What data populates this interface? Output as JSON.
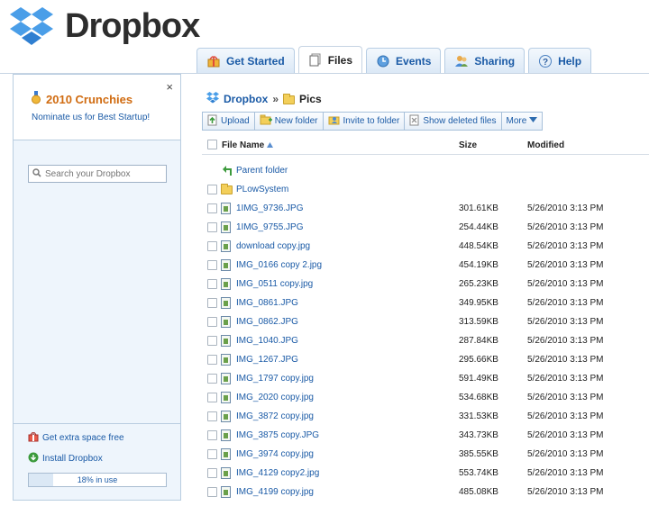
{
  "brand": {
    "name": "Dropbox"
  },
  "tabs": [
    {
      "label": "Get Started",
      "icon": "gift-box-icon",
      "active": false
    },
    {
      "label": "Files",
      "icon": "files-icon",
      "active": true
    },
    {
      "label": "Events",
      "icon": "events-icon",
      "active": false
    },
    {
      "label": "Sharing",
      "icon": "sharing-icon",
      "active": false
    },
    {
      "label": "Help",
      "icon": "help-icon",
      "active": false
    }
  ],
  "sidebar": {
    "promo_title": "2010 Crunchies",
    "promo_sub": "Nominate us for Best Startup!",
    "close": "×",
    "search_placeholder": "Search your Dropbox",
    "links": [
      {
        "label": "Get extra space free",
        "icon": "gift-icon"
      },
      {
        "label": "Install Dropbox",
        "icon": "download-icon"
      }
    ],
    "usage_label": "18% in use",
    "usage_fraction": 0.18
  },
  "breadcrumb": {
    "root": "Dropbox",
    "separator": "»",
    "current": "Pics"
  },
  "toolbar": {
    "upload": "Upload",
    "new_folder": "New folder",
    "invite": "Invite to folder",
    "show_deleted": "Show deleted files",
    "more": "More"
  },
  "table": {
    "headers": {
      "name": "File Name",
      "size": "Size",
      "modified": "Modified"
    },
    "parent_label": "Parent folder",
    "rows": [
      {
        "name": "PLowSystem",
        "type": "folder",
        "size": "",
        "modified": ""
      },
      {
        "name": "1IMG_9736.JPG",
        "type": "image",
        "size": "301.61KB",
        "modified": "5/26/2010 3:13 PM"
      },
      {
        "name": "1IMG_9755.JPG",
        "type": "image",
        "size": "254.44KB",
        "modified": "5/26/2010 3:13 PM"
      },
      {
        "name": "download copy.jpg",
        "type": "image",
        "size": "448.54KB",
        "modified": "5/26/2010 3:13 PM"
      },
      {
        "name": "IMG_0166 copy 2.jpg",
        "type": "image",
        "size": "454.19KB",
        "modified": "5/26/2010 3:13 PM"
      },
      {
        "name": "IMG_0511 copy.jpg",
        "type": "image",
        "size": "265.23KB",
        "modified": "5/26/2010 3:13 PM"
      },
      {
        "name": "IMG_0861.JPG",
        "type": "image",
        "size": "349.95KB",
        "modified": "5/26/2010 3:13 PM"
      },
      {
        "name": "IMG_0862.JPG",
        "type": "image",
        "size": "313.59KB",
        "modified": "5/26/2010 3:13 PM"
      },
      {
        "name": "IMG_1040.JPG",
        "type": "image",
        "size": "287.84KB",
        "modified": "5/26/2010 3:13 PM"
      },
      {
        "name": "IMG_1267.JPG",
        "type": "image",
        "size": "295.66KB",
        "modified": "5/26/2010 3:13 PM"
      },
      {
        "name": "IMG_1797 copy.jpg",
        "type": "image",
        "size": "591.49KB",
        "modified": "5/26/2010 3:13 PM"
      },
      {
        "name": "IMG_2020 copy.jpg",
        "type": "image",
        "size": "534.68KB",
        "modified": "5/26/2010 3:13 PM"
      },
      {
        "name": "IMG_3872 copy.jpg",
        "type": "image",
        "size": "331.53KB",
        "modified": "5/26/2010 3:13 PM"
      },
      {
        "name": "IMG_3875 copy.JPG",
        "type": "image",
        "size": "343.73KB",
        "modified": "5/26/2010 3:13 PM"
      },
      {
        "name": "IMG_3974 copy.jpg",
        "type": "image",
        "size": "385.55KB",
        "modified": "5/26/2010 3:13 PM"
      },
      {
        "name": "IMG_4129 copy2.jpg",
        "type": "image",
        "size": "553.74KB",
        "modified": "5/26/2010 3:13 PM"
      },
      {
        "name": "IMG_4199 copy.jpg",
        "type": "image",
        "size": "485.08KB",
        "modified": "5/26/2010 3:13 PM"
      }
    ]
  }
}
